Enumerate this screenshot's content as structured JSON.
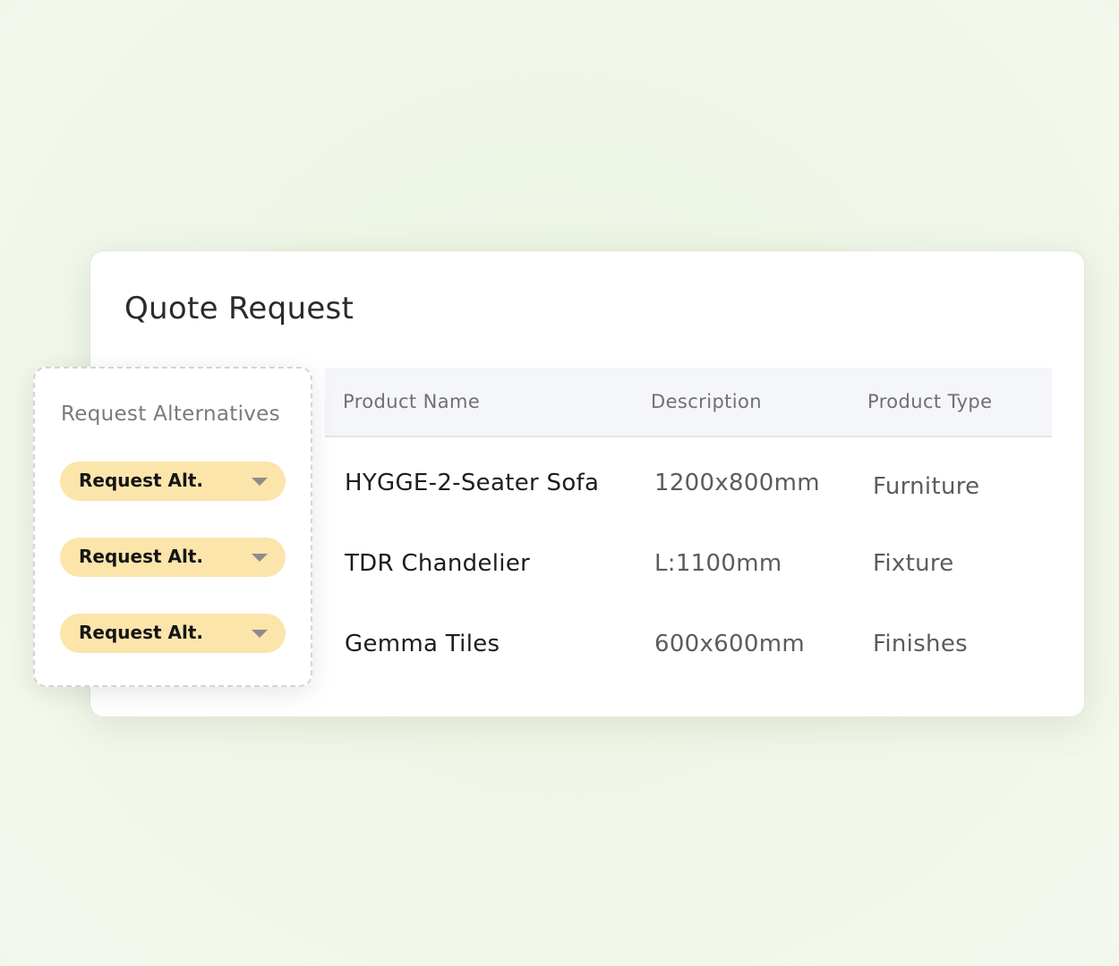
{
  "quote": {
    "title": "Quote Request",
    "columns": [
      "Product Name",
      "Description",
      "Product Type"
    ],
    "rows": [
      {
        "name": "HYGGE-2-Seater Sofa",
        "description": "1200x800mm",
        "type": "Furniture"
      },
      {
        "name": "TDR Chandelier",
        "description": "L:1100mm",
        "type": "Fixture"
      },
      {
        "name": "Gemma Tiles",
        "description": "600x600mm",
        "type": "Finishes"
      }
    ]
  },
  "alternatives": {
    "title": "Request Alternatives",
    "buttons": [
      {
        "label": "Request Alt.",
        "icon": "chevron-down-icon"
      },
      {
        "label": "Request Alt.",
        "icon": "chevron-down-icon"
      },
      {
        "label": "Request Alt.",
        "icon": "chevron-down-icon"
      }
    ]
  },
  "colors": {
    "page_background": "#f1f7ea",
    "card_background": "#ffffff",
    "header_background": "#f5f6fa",
    "alt_button_fill": "#fbe5ab"
  }
}
